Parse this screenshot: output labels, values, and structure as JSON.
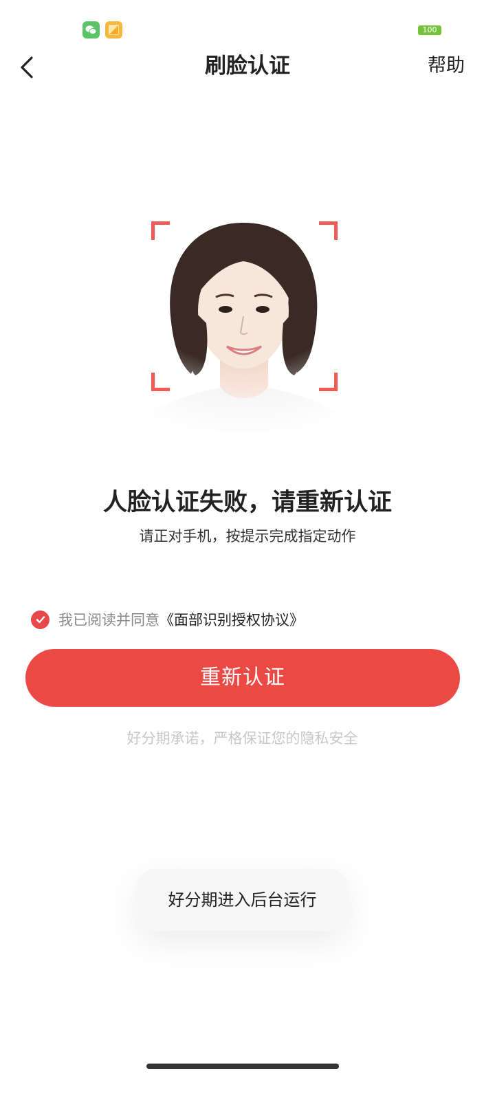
{
  "status_bar": {
    "battery": "100",
    "icons": [
      "wechat-icon",
      "gallery-icon"
    ]
  },
  "nav": {
    "back_icon": "chevron-left-icon",
    "title": "刷脸认证",
    "help": "帮助"
  },
  "illustration": {
    "frame_color": "#ef5b55"
  },
  "message": {
    "title": "人脸认证失败，请重新认证",
    "subtitle": "请正对手机，按提示完成指定动作"
  },
  "agreement": {
    "checked": true,
    "prefix": "我已阅读并同意",
    "link": "《面部识别授权协议》"
  },
  "primary_button": {
    "label": "重新认证",
    "color": "#eb4a44"
  },
  "privacy_note": "好分期承诺，严格保证您的隐私安全",
  "toast": "好分期进入后台运行"
}
